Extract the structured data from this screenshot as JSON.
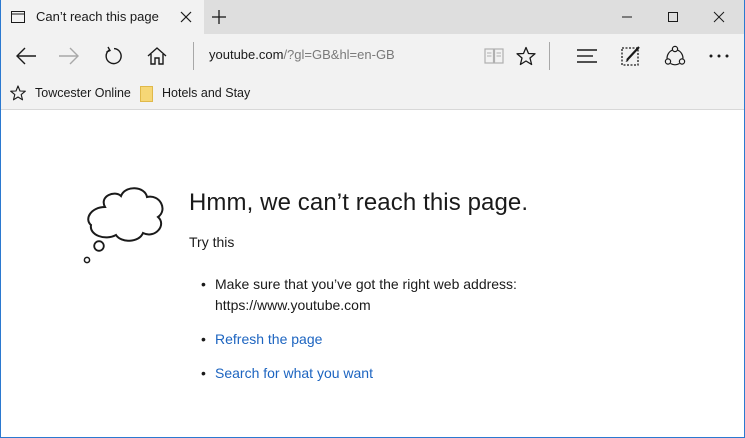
{
  "tab": {
    "title": "Can’t reach this page",
    "icon": "page-icon",
    "close_icon": "close-icon",
    "new_tab_icon": "plus-icon"
  },
  "window_controls": {
    "minimize_icon": "minimize-icon",
    "maximize_icon": "maximize-icon",
    "close_icon": "close-icon"
  },
  "navbar": {
    "back_icon": "back-arrow-icon",
    "forward_icon": "forward-arrow-icon",
    "refresh_icon": "refresh-icon",
    "home_icon": "home-icon",
    "address_domain": "youtube.com",
    "address_rest": "/?gl=GB&hl=en-GB",
    "reading_view_icon": "book-icon",
    "favorite_icon": "star-icon",
    "hub_icon": "hub-lines-icon",
    "note_icon": "web-note-icon",
    "share_icon": "share-icon",
    "more_icon": "more-dots-icon"
  },
  "favorites": {
    "items": [
      {
        "label": "Towcester Online"
      },
      {
        "label": "Hotels and Stay"
      }
    ]
  },
  "error": {
    "heading": "Hmm, we can’t reach this page.",
    "try_this": "Try this",
    "bullet1_line1": "Make sure that you’ve got the right web address:",
    "bullet1_line2": "https://www.youtube.com",
    "refresh_link": "Refresh the page",
    "search_link": "Search for what you want"
  },
  "colors": {
    "link": "#1c64c0",
    "chrome": "#f2f2f2",
    "frame": "#2b79d0",
    "folder": "#f6d776"
  }
}
